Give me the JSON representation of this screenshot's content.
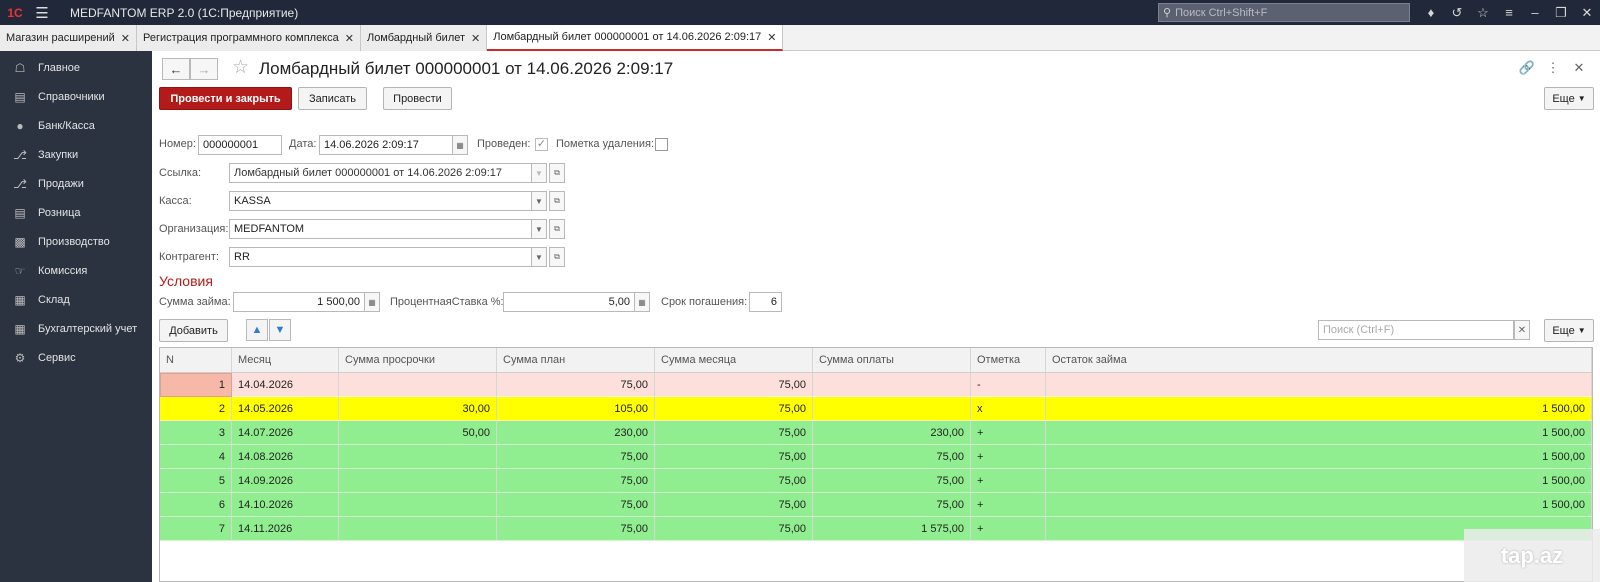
{
  "titlebar": {
    "logo": "1С",
    "app_title": "MEDFANTOM ERP 2.0  (1С:Предприятие)",
    "search_placeholder": "Поиск Ctrl+Shift+F",
    "icons": [
      "bell-icon",
      "history-icon",
      "star-icon",
      "menu-lines-icon",
      "minimize-icon",
      "restore-icon",
      "close-icon"
    ]
  },
  "tabs": [
    {
      "label": "Магазин расширений",
      "active": false
    },
    {
      "label": "Регистрация программного комплекса",
      "active": false
    },
    {
      "label": "Ломбардный билет",
      "active": false
    },
    {
      "label": "Ломбардный билет 000000001 от 14.06.2026 2:09:17",
      "active": true
    }
  ],
  "sidebar": {
    "items": [
      {
        "label": "Главное",
        "icon": "home-icon"
      },
      {
        "label": "Справочники",
        "icon": "book-icon"
      },
      {
        "label": "Банк/Касса",
        "icon": "money-bag-icon"
      },
      {
        "label": "Закупки",
        "icon": "cart-icon"
      },
      {
        "label": "Продажи",
        "icon": "cart-icon"
      },
      {
        "label": "Розница",
        "icon": "register-icon"
      },
      {
        "label": "Производство",
        "icon": "factory-icon"
      },
      {
        "label": "Комиссия",
        "icon": "handshake-icon"
      },
      {
        "label": "Склад",
        "icon": "warehouse-icon"
      },
      {
        "label": "Бухгалтерский учет",
        "icon": "ledger-icon"
      },
      {
        "label": "Сервис",
        "icon": "gear-icon"
      }
    ]
  },
  "document": {
    "title": "Ломбардный билет 000000001 от 14.06.2026 2:09:17",
    "buttons": {
      "post_close": "Провести и закрыть",
      "save": "Записать",
      "post": "Провести",
      "more": "Еще"
    },
    "fields": {
      "number_label": "Номер:",
      "number_value": "000000001",
      "date_label": "Дата:",
      "date_value": "14.06.2026  2:09:17",
      "posted_label": "Проведен:",
      "posted_checked": true,
      "deletion_label": "Пометка удаления:",
      "deletion_checked": false,
      "link_label": "Ссылка:",
      "link_value": "Ломбардный билет 000000001 от 14.06.2026 2:09:17",
      "cash_label": "Касса:",
      "cash_value": "KASSA",
      "org_label": "Организация:",
      "org_value": "MEDFANTOM",
      "counterparty_label": "Контрагент:",
      "counterparty_value": "RR"
    },
    "conditions": {
      "title": "Условия",
      "loan_label": "Сумма займа:",
      "loan_value": "1 500,00",
      "rate_label": "ПроцентнаяСтавка %:",
      "rate_value": "5,00",
      "term_label": "Срок погашения:",
      "term_value": "6"
    },
    "table_toolbar": {
      "add": "Добавить",
      "search_placeholder": "Поиск (Ctrl+F)",
      "more": "Еще"
    },
    "table": {
      "columns": [
        "N",
        "Месяц",
        "Сумма просрочки",
        "Сумма план",
        "Сумма месяца",
        "Сумма оплаты",
        "Отметка",
        "Остаток займа"
      ],
      "rows": [
        {
          "n": "1",
          "month": "14.04.2026",
          "overdue": "",
          "plan": "75,00",
          "monthly": "75,00",
          "paid": "",
          "mark": "-",
          "balance": "",
          "color": "pink"
        },
        {
          "n": "2",
          "month": "14.05.2026",
          "overdue": "30,00",
          "plan": "105,00",
          "monthly": "75,00",
          "paid": "",
          "mark": "x",
          "balance": "1 500,00",
          "color": "yellow"
        },
        {
          "n": "3",
          "month": "14.07.2026",
          "overdue": "50,00",
          "plan": "230,00",
          "monthly": "75,00",
          "paid": "230,00",
          "mark": "+",
          "balance": "1 500,00",
          "color": "green"
        },
        {
          "n": "4",
          "month": "14.08.2026",
          "overdue": "",
          "plan": "75,00",
          "monthly": "75,00",
          "paid": "75,00",
          "mark": "+",
          "balance": "1 500,00",
          "color": "green"
        },
        {
          "n": "5",
          "month": "14.09.2026",
          "overdue": "",
          "plan": "75,00",
          "monthly": "75,00",
          "paid": "75,00",
          "mark": "+",
          "balance": "1 500,00",
          "color": "green"
        },
        {
          "n": "6",
          "month": "14.10.2026",
          "overdue": "",
          "plan": "75,00",
          "monthly": "75,00",
          "paid": "75,00",
          "mark": "+",
          "balance": "1 500,00",
          "color": "green"
        },
        {
          "n": "7",
          "month": "14.11.2026",
          "overdue": "",
          "plan": "75,00",
          "monthly": "75,00",
          "paid": "1 575,00",
          "mark": "+",
          "balance": "",
          "color": "green"
        }
      ]
    }
  },
  "watermark": "tap.az",
  "colors": {
    "brand_red": "#b31b1b",
    "row_pink": "#fde0dc",
    "row_yellow": "#ffff00",
    "row_green": "#90ee90",
    "sidebar_bg": "#2b3240",
    "titlebar_bg": "#20283a"
  }
}
